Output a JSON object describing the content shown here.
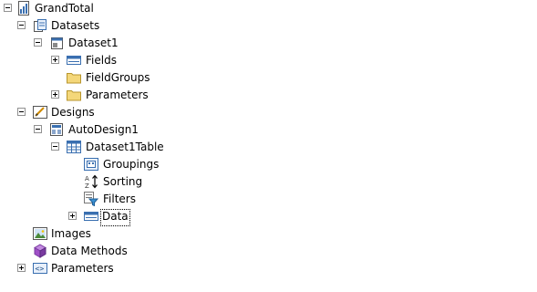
{
  "tree": {
    "grandtotal": "GrandTotal",
    "datasets": "Datasets",
    "dataset1": "Dataset1",
    "fields": "Fields",
    "fieldgroups": "FieldGroups",
    "parameters_ds": "Parameters",
    "designs": "Designs",
    "autodesign1": "AutoDesign1",
    "dataset1table": "Dataset1Table",
    "groupings": "Groupings",
    "sorting": "Sorting",
    "filters": "Filters",
    "data": "Data",
    "images": "Images",
    "datamethods": "Data Methods",
    "parameters_root": "Parameters"
  },
  "icons": {
    "grandtotal": "report-icon",
    "datasets": "datasets-icon",
    "dataset1": "dataset-icon",
    "fields": "fields-icon",
    "fieldgroups": "folder-icon",
    "parameters_ds": "folder-icon",
    "designs": "designs-icon",
    "autodesign1": "autodesign-icon",
    "dataset1table": "table-icon",
    "groupings": "groupings-icon",
    "sorting": "sorting-icon",
    "filters": "filters-icon",
    "data": "data-icon",
    "images": "images-icon",
    "datamethods": "data-methods-icon",
    "parameters_root": "parameters-icon"
  },
  "colors": {
    "folder": "#f4d77a",
    "expander_border": "#919191",
    "icon_blue": "#3a6fb0",
    "data_methods_purple": "#a050c8"
  }
}
